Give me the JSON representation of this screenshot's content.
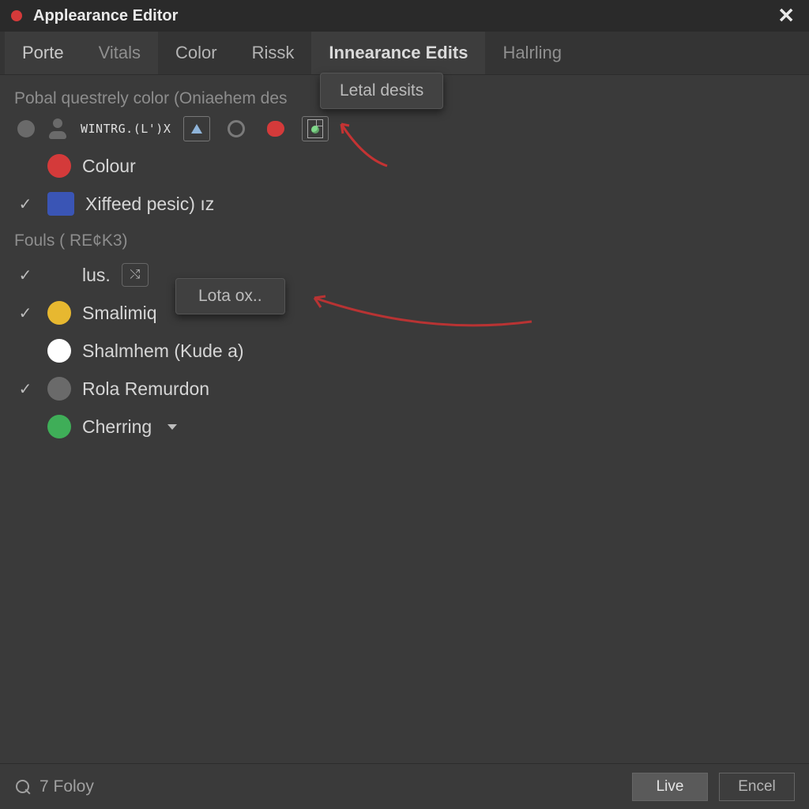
{
  "window": {
    "title": "Applearance Editor"
  },
  "tabs": [
    {
      "id": "porte",
      "label": "Porte"
    },
    {
      "id": "vitals",
      "label": "Vitals"
    },
    {
      "id": "color",
      "label": "Color"
    },
    {
      "id": "rissk",
      "label": "Rissk"
    },
    {
      "id": "innearance",
      "label": "Innearance Edits"
    },
    {
      "id": "halrling",
      "label": "Halrling"
    }
  ],
  "tab_dropdown": {
    "label": "Letal desits"
  },
  "sections": {
    "top": {
      "heading": "Pobal questrely color (Oniaehem des",
      "toolbar": {
        "label": "WINTRG.(L')X"
      },
      "items": [
        {
          "swatchColor": "#d43a3a",
          "label": "Colour",
          "checked": false,
          "shape": "circle"
        },
        {
          "swatchColor": "#3a55b5",
          "label": "Xiffeed pesic) ız",
          "checked": true,
          "shape": "square"
        }
      ]
    },
    "fouls": {
      "heading": "Fouls ( RE¢K3)",
      "items": [
        {
          "swatchColor": null,
          "label": "lus.",
          "checked": true,
          "extraBtn": true
        },
        {
          "swatchColor": "#e7b830",
          "label": "Smalimiq",
          "checked": true
        },
        {
          "swatchColor": "#ffffff",
          "label": "Shalmhem (Kude a)",
          "checked": false
        },
        {
          "swatchColor": "#6a6a6a",
          "label": "Rola Remurdon",
          "checked": true
        },
        {
          "swatchColor": "#3fae58",
          "label": "Cherring",
          "checked": false,
          "caret": true
        }
      ]
    }
  },
  "floating_tip": {
    "label": "Lota ox.."
  },
  "footer": {
    "status": "7 Foloy",
    "primary": "Live",
    "secondary": "Encel"
  },
  "colors": {
    "accent_red": "#d43a3a"
  }
}
